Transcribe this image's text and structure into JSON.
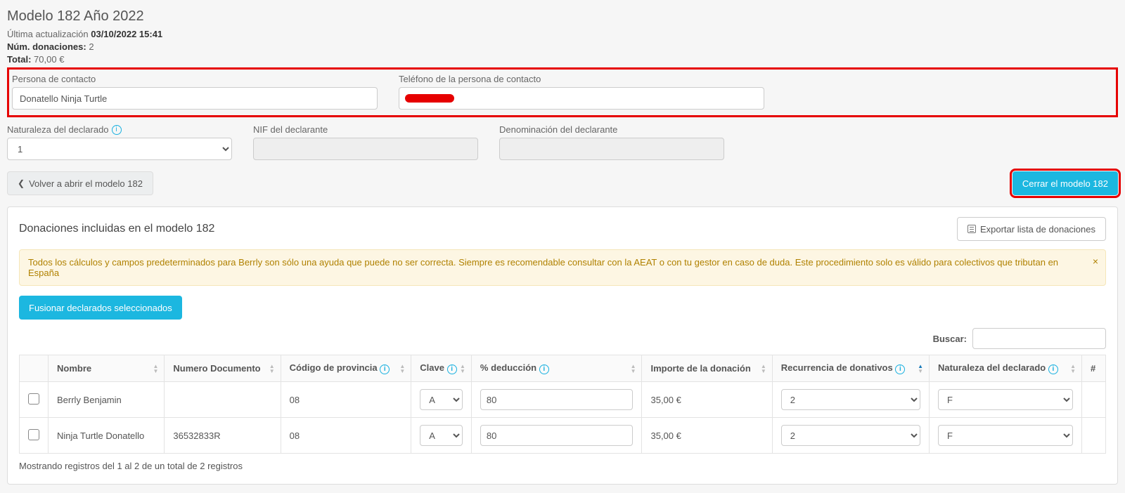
{
  "header": {
    "title": "Modelo 182 Año 2022",
    "last_update_label": "Última actualización",
    "last_update_value": "03/10/2022 15:41",
    "num_donations_label": "Núm. donaciones:",
    "num_donations_value": "2",
    "total_label": "Total:",
    "total_value": "70,00 €"
  },
  "contact": {
    "person_label": "Persona de contacto",
    "person_value": "Donatello Ninja Turtle",
    "phone_label": "Teléfono de la persona de contacto"
  },
  "declarant": {
    "naturaleza_label": "Naturaleza del declarado",
    "naturaleza_value": "1",
    "nif_label": "NIF del declarante",
    "nif_value": "",
    "denominacion_label": "Denominación del declarante",
    "denominacion_value": ""
  },
  "actions": {
    "reopen": "Volver a abrir el modelo 182",
    "close": "Cerrar el modelo 182"
  },
  "panel": {
    "title": "Donaciones incluidas en el modelo 182",
    "export": "Exportar lista de donaciones",
    "alert": "Todos los cálculos y campos predeterminados para Berrly son sólo una ayuda que puede no ser correcta. Siempre es recomendable consultar con la AEAT o con tu gestor en caso de duda. Este procedimiento solo es válido para colectivos que tributan en España",
    "merge": "Fusionar declarados seleccionados",
    "search_label": "Buscar:"
  },
  "table": {
    "cols": {
      "nombre": "Nombre",
      "numdoc": "Numero Documento",
      "provincia": "Código de provincia",
      "clave": "Clave",
      "deduccion": "% deducción",
      "importe": "Importe de la donación",
      "recurrencia": "Recurrencia de donativos",
      "naturaleza": "Naturaleza del declarado",
      "hash": "#"
    },
    "rows": [
      {
        "nombre": "Berrly Benjamin",
        "numdoc": "",
        "provincia": "08",
        "clave": "A",
        "deduccion": "80",
        "importe": "35,00 €",
        "recurrencia": "2",
        "naturaleza": "F"
      },
      {
        "nombre": "Ninja Turtle Donatello",
        "numdoc": "36532833R",
        "provincia": "08",
        "clave": "A",
        "deduccion": "80",
        "importe": "35,00 €",
        "recurrencia": "2",
        "naturaleza": "F"
      }
    ],
    "footer": "Mostrando registros del 1 al 2 de un total de 2 registros"
  }
}
